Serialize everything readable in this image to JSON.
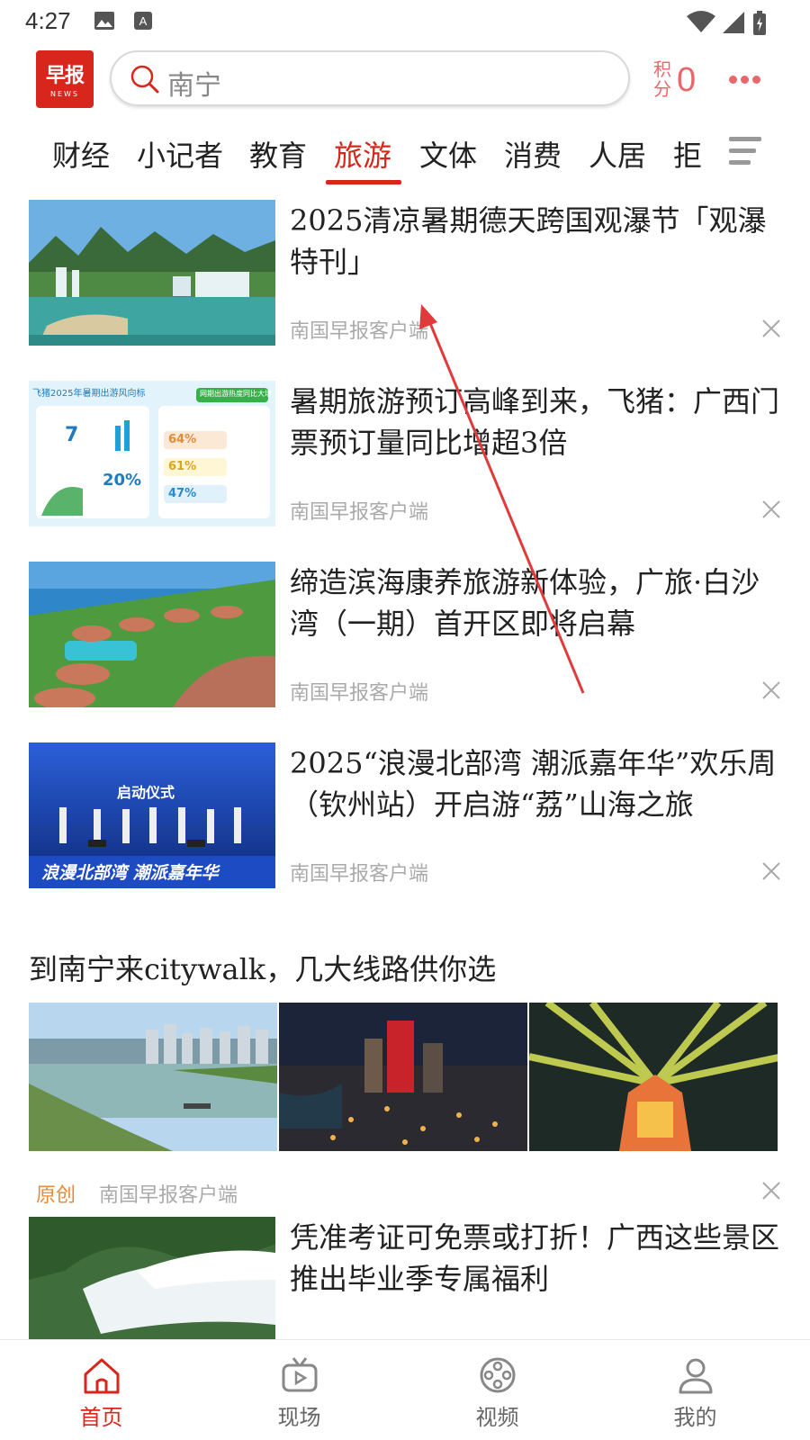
{
  "status_bar": {
    "time": "4:27"
  },
  "header": {
    "logo_text": "早报",
    "logo_sub": "NEWS",
    "search_value": "南宁",
    "points_label": "积分",
    "points_value": "0"
  },
  "tabs": [
    {
      "label": "财经",
      "active": false
    },
    {
      "label": "小记者",
      "active": false
    },
    {
      "label": "教育",
      "active": false
    },
    {
      "label": "旅游",
      "active": true
    },
    {
      "label": "文体",
      "active": false
    },
    {
      "label": "消费",
      "active": false
    },
    {
      "label": "人居",
      "active": false
    },
    {
      "label": "拒",
      "active": false
    }
  ],
  "articles": [
    {
      "title": "2025清凉暑期德天跨国观瀑节「观瀑特刊」",
      "source": "南国早报客户端"
    },
    {
      "title": "暑期旅游预订高峰到来，飞猪：广西门票预订量同比增超3倍",
      "source": "南国早报客户端"
    },
    {
      "title": "缔造滨海康养旅游新体验，广旅·白沙湾（一期）首开区即将启幕",
      "source": "南国早报客户端"
    },
    {
      "title": "2025“浪漫北部湾 潮派嘉年华”欢乐周（钦州站）开启游“荔”山海之旅",
      "source": "南国早报客户端"
    }
  ],
  "thumb_texts": {
    "infographic_title": "飞猪2025年暑期出游风向标",
    "infographic_tag": "网期出游热度同比大增",
    "infographic_big": "20%",
    "infographic_p1": "64%",
    "infographic_p2": "61%",
    "infographic_p3": "47%",
    "infographic_seven": "7",
    "stage_title": "启动仪式",
    "stage_banner": "浪漫北部湾 潮派嘉年华"
  },
  "gallery": {
    "title": "到南宁来citywalk，几大线路供你选",
    "badge": "原创",
    "source": "南国早报客户端"
  },
  "last_article": {
    "title": "凭准考证可免票或打折！广西这些景区推出毕业季专属福利"
  },
  "bottom_nav": [
    {
      "label": "首页",
      "icon": "home-icon",
      "active": true
    },
    {
      "label": "现场",
      "icon": "live-tv-icon",
      "active": false
    },
    {
      "label": "视频",
      "icon": "film-reel-icon",
      "active": false
    },
    {
      "label": "我的",
      "icon": "user-icon",
      "active": false
    }
  ],
  "colors": {
    "brand": "#d9261c",
    "points": "#e9676a",
    "original_badge": "#e98a3a",
    "arrow": "#e03a3a"
  }
}
